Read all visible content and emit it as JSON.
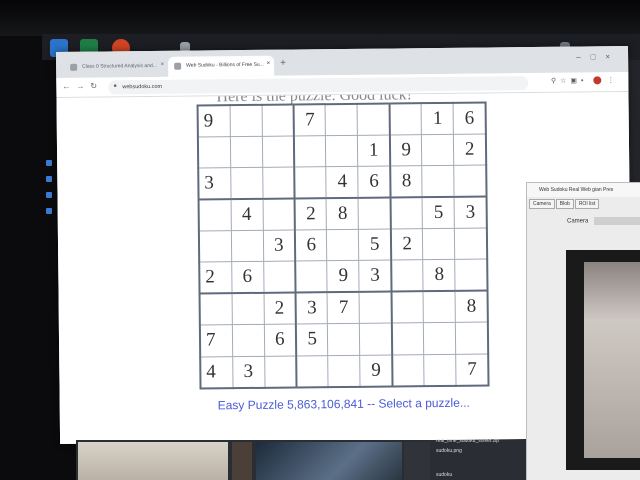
{
  "browser": {
    "tabs": [
      {
        "label": "Class 0 Structured Analysis and..."
      },
      {
        "label": "Web Sudoku - Billions of Free Su..."
      }
    ],
    "url": "websudoku.com",
    "page_heading": "Here is the puzzle. Good luck!"
  },
  "sudoku": {
    "rows": [
      [
        "9",
        "",
        "",
        "7",
        "",
        "",
        "",
        "1",
        "6"
      ],
      [
        "",
        "",
        "",
        "",
        "",
        "1",
        "9",
        "",
        "2"
      ],
      [
        "3",
        "",
        "",
        "",
        "4",
        "6",
        "8",
        "",
        ""
      ],
      [
        "",
        "4",
        "",
        "2",
        "8",
        "",
        "",
        "5",
        "3"
      ],
      [
        "",
        "",
        "3",
        "6",
        "",
        "5",
        "2",
        "",
        ""
      ],
      [
        "2",
        "6",
        "",
        "",
        "9",
        "3",
        "",
        "8",
        ""
      ],
      [
        "",
        "",
        "2",
        "3",
        "7",
        "",
        "",
        "",
        "8"
      ],
      [
        "7",
        "",
        "6",
        "5",
        "",
        "",
        "",
        "",
        ""
      ],
      [
        "4",
        "3",
        "",
        "",
        "",
        "9",
        "",
        "",
        "7"
      ]
    ]
  },
  "footer": {
    "link_text": "Easy Puzzle 5,863,106,841 -- Select a puzzle..."
  },
  "camera_window": {
    "title": "Web Sudoku Real Web gian Pres",
    "tabs": [
      "Camera",
      "Blob",
      "ROI list"
    ],
    "camera_label": "Camera"
  },
  "taskbar_files": [
    "real_time_sudoku_solver.zip",
    "sudoku.png",
    "sudoku"
  ],
  "colors": {
    "grid_thick": "#606a7c",
    "grid_thin": "#a4aab8",
    "link": "#4a5bd8"
  }
}
